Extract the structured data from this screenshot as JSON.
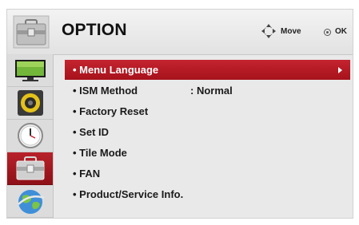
{
  "header": {
    "title": "OPTION",
    "hint_move": "Move",
    "hint_ok": "OK"
  },
  "sidebar": {
    "items": [
      {
        "icon": "tv-picture-icon",
        "selected": false
      },
      {
        "icon": "speaker-audio-icon",
        "selected": false
      },
      {
        "icon": "clock-time-icon",
        "selected": false
      },
      {
        "icon": "toolbox-option-icon",
        "selected": true
      },
      {
        "icon": "globe-network-icon",
        "selected": false
      }
    ]
  },
  "menu": {
    "items": [
      {
        "label": "• Menu Language",
        "value": "",
        "selected": true
      },
      {
        "label": "• ISM Method",
        "value": ": Normal",
        "selected": false
      },
      {
        "label": "• Factory Reset",
        "value": "",
        "selected": false
      },
      {
        "label": "• Set ID",
        "value": "",
        "selected": false
      },
      {
        "label": "• Tile Mode",
        "value": "",
        "selected": false
      },
      {
        "label": "• FAN",
        "value": "",
        "selected": false
      },
      {
        "label": "• Product/Service Info.",
        "value": "",
        "selected": false
      }
    ]
  },
  "colors": {
    "highlight": "#b01a24",
    "panel": "#e9e9e9",
    "text": "#1a1a1a"
  }
}
